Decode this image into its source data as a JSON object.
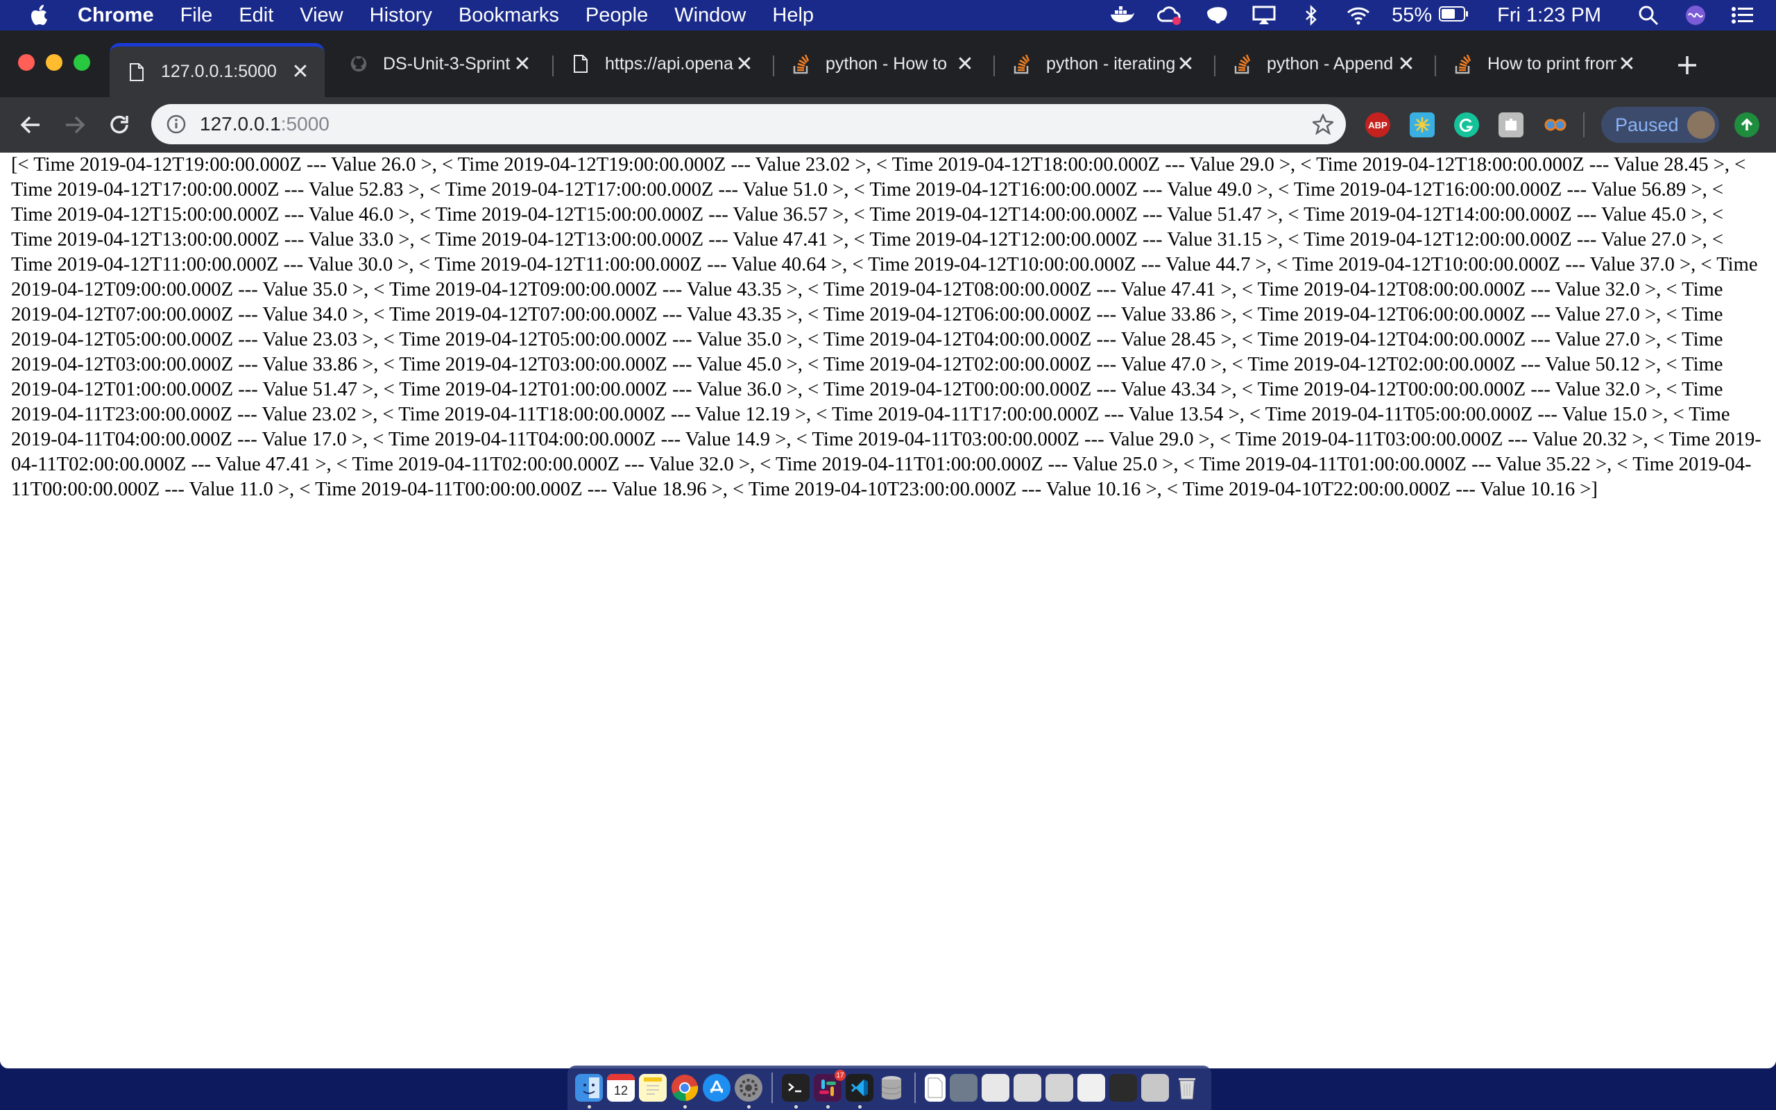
{
  "menubar": {
    "app_name": "Chrome",
    "menus": [
      "File",
      "Edit",
      "View",
      "History",
      "Bookmarks",
      "People",
      "Window",
      "Help"
    ],
    "battery_percent": "55%",
    "clock": "Fri 1:23 PM"
  },
  "tabs": [
    {
      "title": "127.0.0.1:5000",
      "icon": "page-icon",
      "active": true
    },
    {
      "title": "DS-Unit-3-Sprint",
      "icon": "github-icon",
      "active": false
    },
    {
      "title": "https://api.opena",
      "icon": "page-icon",
      "active": false
    },
    {
      "title": "python - How to",
      "icon": "stackoverflow-icon",
      "active": false
    },
    {
      "title": "python - iterating",
      "icon": "stackoverflow-icon",
      "active": false
    },
    {
      "title": "python - Append",
      "icon": "stackoverflow-icon",
      "active": false
    },
    {
      "title": "How to print from",
      "icon": "stackoverflow-icon",
      "active": false
    }
  ],
  "address_bar": {
    "host": "127.0.0.1",
    "port": ":5000"
  },
  "extensions": {
    "abp_label": "ABP"
  },
  "profile": {
    "status_label": "Paused"
  },
  "page": {
    "body_text": "[< Time 2019-04-12T19:00:00.000Z --- Value 26.0 >, < Time 2019-04-12T19:00:00.000Z --- Value 23.02 >, < Time 2019-04-12T18:00:00.000Z --- Value 29.0 >, < Time 2019-04-12T18:00:00.000Z --- Value 28.45 >, < Time 2019-04-12T17:00:00.000Z --- Value 52.83 >, < Time 2019-04-12T17:00:00.000Z --- Value 51.0 >, < Time 2019-04-12T16:00:00.000Z --- Value 49.0 >, < Time 2019-04-12T16:00:00.000Z --- Value 56.89 >, < Time 2019-04-12T15:00:00.000Z --- Value 46.0 >, < Time 2019-04-12T15:00:00.000Z --- Value 36.57 >, < Time 2019-04-12T14:00:00.000Z --- Value 51.47 >, < Time 2019-04-12T14:00:00.000Z --- Value 45.0 >, < Time 2019-04-12T13:00:00.000Z --- Value 33.0 >, < Time 2019-04-12T13:00:00.000Z --- Value 47.41 >, < Time 2019-04-12T12:00:00.000Z --- Value 31.15 >, < Time 2019-04-12T12:00:00.000Z --- Value 27.0 >, < Time 2019-04-12T11:00:00.000Z --- Value 30.0 >, < Time 2019-04-12T11:00:00.000Z --- Value 40.64 >, < Time 2019-04-12T10:00:00.000Z --- Value 44.7 >, < Time 2019-04-12T10:00:00.000Z --- Value 37.0 >, < Time 2019-04-12T09:00:00.000Z --- Value 35.0 >, < Time 2019-04-12T09:00:00.000Z --- Value 43.35 >, < Time 2019-04-12T08:00:00.000Z --- Value 47.41 >, < Time 2019-04-12T08:00:00.000Z --- Value 32.0 >, < Time 2019-04-12T07:00:00.000Z --- Value 34.0 >, < Time 2019-04-12T07:00:00.000Z --- Value 43.35 >, < Time 2019-04-12T06:00:00.000Z --- Value 33.86 >, < Time 2019-04-12T06:00:00.000Z --- Value 27.0 >, < Time 2019-04-12T05:00:00.000Z --- Value 23.03 >, < Time 2019-04-12T05:00:00.000Z --- Value 35.0 >, < Time 2019-04-12T04:00:00.000Z --- Value 28.45 >, < Time 2019-04-12T04:00:00.000Z --- Value 27.0 >, < Time 2019-04-12T03:00:00.000Z --- Value 33.86 >, < Time 2019-04-12T03:00:00.000Z --- Value 45.0 >, < Time 2019-04-12T02:00:00.000Z --- Value 47.0 >, < Time 2019-04-12T02:00:00.000Z --- Value 50.12 >, < Time 2019-04-12T01:00:00.000Z --- Value 51.47 >, < Time 2019-04-12T01:00:00.000Z --- Value 36.0 >, < Time 2019-04-12T00:00:00.000Z --- Value 43.34 >, < Time 2019-04-12T00:00:00.000Z --- Value 32.0 >, < Time 2019-04-11T23:00:00.000Z --- Value 23.02 >, < Time 2019-04-11T18:00:00.000Z --- Value 12.19 >, < Time 2019-04-11T17:00:00.000Z --- Value 13.54 >, < Time 2019-04-11T05:00:00.000Z --- Value 15.0 >, < Time 2019-04-11T04:00:00.000Z --- Value 17.0 >, < Time 2019-04-11T04:00:00.000Z --- Value 14.9 >, < Time 2019-04-11T03:00:00.000Z --- Value 29.0 >, < Time 2019-04-11T03:00:00.000Z --- Value 20.32 >, < Time 2019-04-11T02:00:00.000Z --- Value 47.41 >, < Time 2019-04-11T02:00:00.000Z --- Value 32.0 >, < Time 2019-04-11T01:00:00.000Z --- Value 25.0 >, < Time 2019-04-11T01:00:00.000Z --- Value 35.22 >, < Time 2019-04-11T00:00:00.000Z --- Value 11.0 >, < Time 2019-04-11T00:00:00.000Z --- Value 18.96 >, < Time 2019-04-10T23:00:00.000Z --- Value 10.16 >, < Time 2019-04-10T22:00:00.000Z --- Value 10.16 >]"
  },
  "dock": {
    "calendar_day": "12",
    "slack_badge": "17",
    "apps": [
      "finder-icon",
      "calendar-icon",
      "notes-icon",
      "chrome-icon",
      "app-store-icon",
      "system-preferences-icon",
      "terminal-icon",
      "slack-icon",
      "vscode-icon",
      "database-icon",
      "document-icon",
      "folder-icon",
      "trash-icon"
    ]
  }
}
